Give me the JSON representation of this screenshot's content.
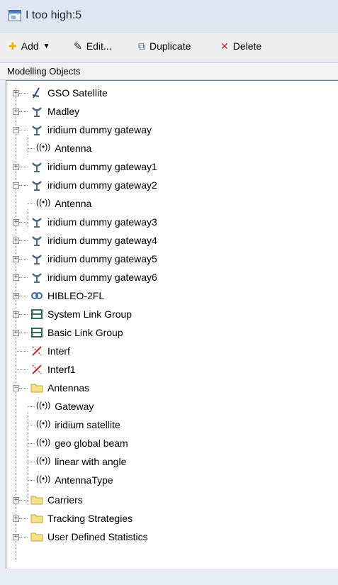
{
  "window": {
    "title": "I too high:5"
  },
  "toolbar": {
    "add_label": "Add",
    "edit_label": "Edit...",
    "duplicate_label": "Duplicate",
    "delete_label": "Delete"
  },
  "panel": {
    "header": "Modelling Objects"
  },
  "tree": {
    "gso_satellite": "GSO Satellite",
    "madley": "Madley",
    "iridium_gateway": "iridium dummy gateway",
    "iridium_gateway_antenna": "Antenna",
    "iridium_gateway1": "iridium dummy gateway1",
    "iridium_gateway2": "iridium dummy gateway2",
    "iridium_gateway2_antenna": "Antenna",
    "iridium_gateway3": "iridium dummy gateway3",
    "iridium_gateway4": "iridium dummy gateway4",
    "iridium_gateway5": "iridium dummy gateway5",
    "iridium_gateway6": "iridium dummy gateway6",
    "hibleo": "HIBLEO-2FL",
    "system_link_group": "System Link Group",
    "basic_link_group": "Basic Link Group",
    "interf": "Interf",
    "interf1": "Interf1",
    "antennas": "Antennas",
    "antennas_children": [
      "Gateway",
      "iridium satellite",
      "geo global beam",
      "linear with angle",
      "AntennaType"
    ],
    "carriers": "Carriers",
    "tracking_strategies": "Tracking Strategies",
    "user_defined_statistics": "User Defined Statistics"
  }
}
